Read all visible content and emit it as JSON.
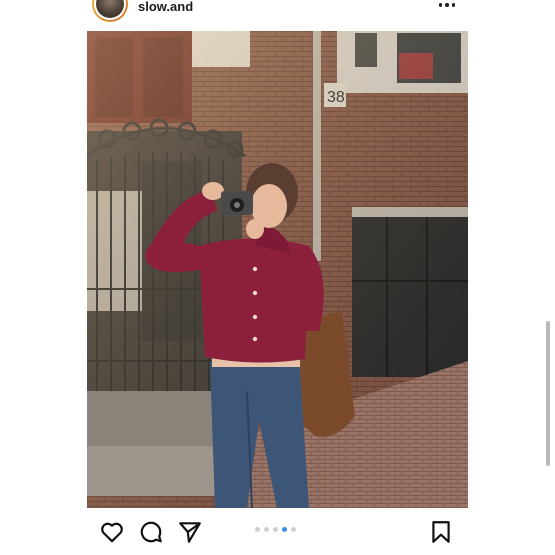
{
  "post": {
    "username": "slow.and",
    "carousel": {
      "count": 5,
      "active_index": 3
    }
  },
  "icons": {
    "more": "more-horizontal-icon",
    "like": "heart-icon",
    "comment": "comment-icon",
    "share": "send-icon",
    "save": "bookmark-icon"
  },
  "colors": {
    "active_dot": "#3d8fe6",
    "inactive_dot": "#cfcfcf"
  }
}
